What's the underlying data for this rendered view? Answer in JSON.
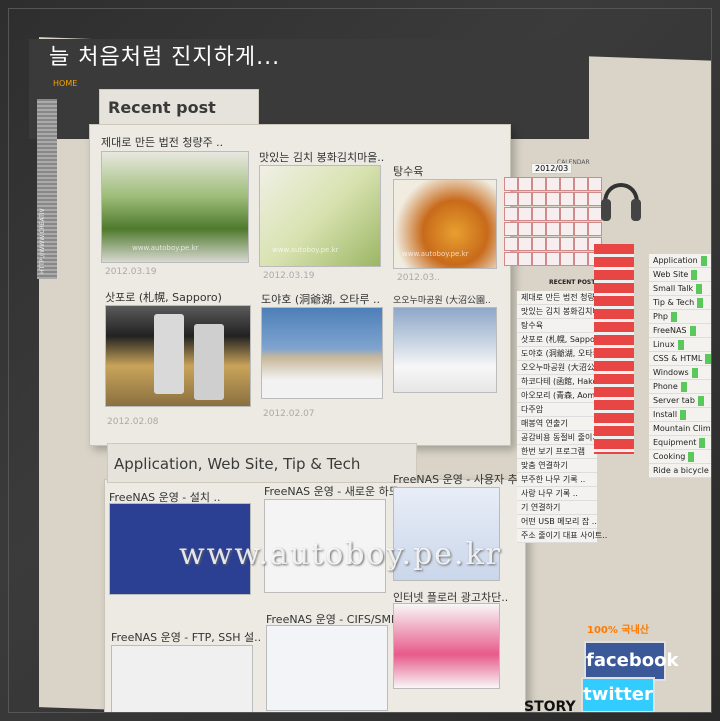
{
  "site": {
    "title": "늘 처음처럼 진지하게...",
    "home": "HOME",
    "side_banner": "HTTP://WWW.CREATIV"
  },
  "recent_post": {
    "heading": "Recent post",
    "posts": [
      {
        "title": "제대로 만든 법전 청량주 ..",
        "date": "2012.03.19"
      },
      {
        "title": "맛있는 김치 봉화김치마을..",
        "date": "2012.03.19"
      },
      {
        "title": "탕수육",
        "date": "2012.03.."
      },
      {
        "title": "삿포로 (札幌, Sapporo)",
        "date": "2012.02.08"
      },
      {
        "title": "도야호 (洞爺湖, 오타루 ..",
        "date": "2012.02.07"
      },
      {
        "title": "오오누마공원 (大沼公園..",
        "date": ""
      }
    ]
  },
  "app_section": {
    "heading": "Application, Web Site, Tip & Tech",
    "posts": [
      {
        "title": "FreeNAS 운영 - 설치 .."
      },
      {
        "title": "FreeNAS 운영 - 새로운 하드.."
      },
      {
        "title": "FreeNAS 운영 - 사용자 추가.."
      },
      {
        "title": "FreeNAS 운영 - FTP, SSH 설.."
      },
      {
        "title": "FreeNAS 운영 - CIFS/SMB 설정"
      },
      {
        "title": "인터넷 플로러 광고차단.."
      }
    ]
  },
  "watermark": "www.autoboy.pe.kr",
  "thumb_watermark": "www.autoboy.pe.kr",
  "calendar": {
    "label": "CALENDAR",
    "month": "2012/03"
  },
  "recent_post_small": "RECENT POST",
  "right_list": [
    "제대로 만든 법전 청량주 ..",
    "맛있는 김치 봉화김치마을 ..",
    "탕수육",
    "삿포로 (札幌, Sapporo)",
    "도야호 (洞爺湖, 오타루 (..",
    "오오누마공원 (大沼公園..",
    "하코다테 (函館, Hakodate)",
    "아오모리 (青森, Aomori)",
    "다주암",
    "매봉역 연출기",
    "공감비용 동절비 줄이기",
    "한번 보기 프로그램",
    "맞춤 연결하기",
    "부주한 나무 기록 ..",
    "사랑 나무 기록 ..",
    "기 연결하기",
    "어떤 USB 메모리 잡 ..",
    "주소 줄이기 대표 사이트.."
  ],
  "categories": [
    "Application",
    "Web Site",
    "Small Talk",
    "Tip & Tech",
    "Php",
    "FreeNAS",
    "Linux",
    "CSS & HTML",
    "Windows",
    "Phone",
    "Server tab",
    "Install",
    "Mountain Climbing",
    "Equipment",
    "Cooking",
    "Ride a bicycle"
  ],
  "promo": "100% 국내산",
  "facebook": "facebook",
  "twitter": "twitter",
  "tistory": "STORY",
  "colors": {
    "facebook": "#3b5998",
    "twitter": "#33ccff",
    "accent_orange": "#f7a300",
    "category_green": "#5bc85b",
    "calendar_red": "#e84545"
  }
}
